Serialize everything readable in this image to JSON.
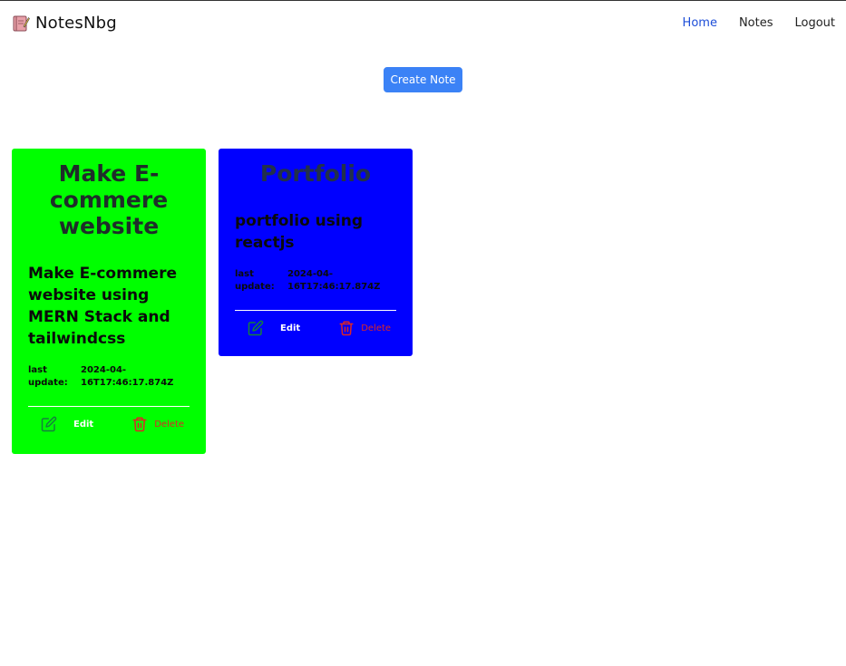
{
  "app": {
    "brand": "NotesNbg"
  },
  "nav": {
    "home": "Home",
    "notes": "Notes",
    "logout": "Logout"
  },
  "actions": {
    "create_note": "Create Note"
  },
  "notes": [
    {
      "title": "Make E-commere website",
      "description": "Make E-commere website using MERN Stack and tailwindcss",
      "updated_label": "last update:",
      "updated_value": "2024-04-16T17:46:17.874Z",
      "edit_label": "Edit",
      "delete_label": "Delete",
      "color": "#00ff00"
    },
    {
      "title": "Portfolio",
      "description": "portfolio using reactjs",
      "updated_label": "last update:",
      "updated_value": "2024-04-16T17:46:17.874Z",
      "edit_label": "Edit",
      "delete_label": "Delete",
      "color": "#0000ff"
    }
  ],
  "colors": {
    "primary": "#3b82f6",
    "nav_active": "#1d4ed8",
    "delete": "#dc2626"
  }
}
